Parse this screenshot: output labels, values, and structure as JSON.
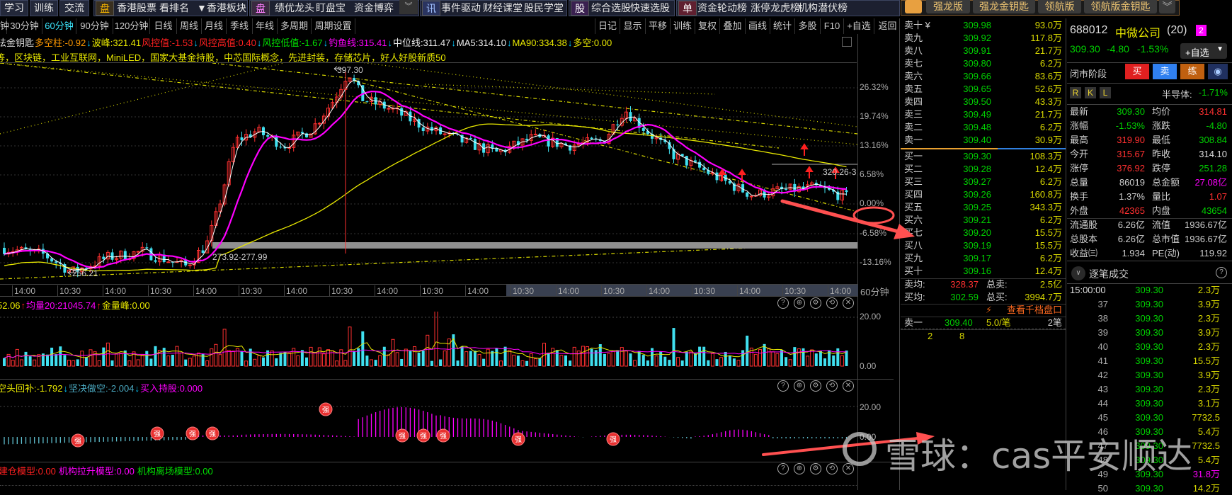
{
  "top_toolbar": {
    "left_buttons": [
      "学习",
      "训练",
      "交流"
    ],
    "group1_icon": "盘",
    "group1": [
      "香港股票",
      "看排名",
      "▼香港板块"
    ],
    "group2_icon": "盘",
    "group2": [
      "绩优龙头",
      "盯盘宝",
      "资金博弈"
    ],
    "group3_icon": "讯",
    "group3": [
      "事件驱动",
      "财经课堂",
      "股民学堂"
    ],
    "group4_icon": "股",
    "group4": [
      "综合选股",
      "快速选股"
    ],
    "group5_icon": "单",
    "group5": [
      "资金轮动榜",
      "涨停龙虎榜",
      "机构潜伏榜"
    ],
    "version_tabs": [
      "强龙版",
      "强龙金钥匙",
      "领航版",
      "领航版金钥匙"
    ]
  },
  "periods": [
    "钟",
    "30分钟",
    "60分钟",
    "90分钟",
    "120分钟",
    "日线",
    "周线",
    "月线",
    "季线",
    "年线",
    "多周期",
    "周期设置"
  ],
  "active_period": "60分钟",
  "chart_tools": [
    "日记",
    "显示",
    "平移",
    "训练",
    "复权",
    "叠加",
    "画线",
    "统计",
    "多股",
    "F10",
    "+自选",
    "返回"
  ],
  "indicator_line": [
    {
      "t": "法金钥匙",
      "c": "#dddddd"
    },
    {
      "t": "多空柱:-0.92",
      "c": "#ff9900"
    },
    {
      "t": "↓",
      "c": "#00c8ff"
    },
    {
      "t": "波峰:321.41",
      "c": "#e8e800"
    },
    {
      "t": "风控值:-1.53",
      "c": "#ff2020"
    },
    {
      "t": "↓",
      "c": "#00c8ff"
    },
    {
      "t": "风控高值:0.40",
      "c": "#ff2020"
    },
    {
      "t": "↓",
      "c": "#00c8ff"
    },
    {
      "t": "风控低值:-1.67",
      "c": "#00e000"
    },
    {
      "t": "↓",
      "c": "#00c8ff"
    },
    {
      "t": "钓鱼线:315.41",
      "c": "#ff00ff"
    },
    {
      "t": "↓",
      "c": "#00c8ff"
    },
    {
      "t": "中位线:311.47",
      "c": "#eeeeee"
    },
    {
      "t": "↓",
      "c": "#00c8ff"
    },
    {
      "t": "MA5:314.10",
      "c": "#eeeeee"
    },
    {
      "t": "↓",
      "c": "#00c8ff"
    },
    {
      "t": "MA90:334.38",
      "c": "#e8e800"
    },
    {
      "t": "↓",
      "c": "#00c8ff"
    },
    {
      "t": "多空:0.00",
      "c": "#e8e800"
    }
  ],
  "concepts": "等，区块链，工业互联网，MiniLED，国家大基金持股，中芯国际概念，先进封装，存储芯片，好人好股新质50",
  "main_chart": {
    "pct_labels": [
      "26.32%",
      "19.74%",
      "13.16%",
      "6.58%",
      "0.00%",
      "-6.58%",
      "-13.16%"
    ],
    "time_labels": [
      "14:00",
      "10:30",
      "14:00",
      "10:30",
      "14:00",
      "10:30",
      "14:00",
      "10:30",
      "14:00",
      "10:30",
      "14:00",
      "10:30",
      "14:00",
      "10:30",
      "14:00",
      "10:30",
      "14:00",
      "10:30",
      "14:00"
    ],
    "period_label": "60分钟",
    "annotations": {
      "high": "397.30",
      "low": "256.21",
      "band": "273.92-277.99",
      "range": "320.26-3"
    },
    "price_path": [
      [
        0,
        274.7
      ],
      [
        60,
        270
      ],
      [
        100,
        258
      ],
      [
        150,
        268
      ],
      [
        200,
        272
      ],
      [
        260,
        262
      ],
      [
        290,
        277
      ],
      [
        305,
        299
      ],
      [
        330,
        348
      ],
      [
        360,
        355
      ],
      [
        400,
        345
      ],
      [
        440,
        357
      ],
      [
        470,
        377
      ],
      [
        490,
        396
      ],
      [
        510,
        377
      ],
      [
        550,
        370
      ],
      [
        600,
        357
      ],
      [
        650,
        348
      ],
      [
        700,
        340
      ],
      [
        750,
        350
      ],
      [
        800,
        345
      ],
      [
        850,
        348
      ],
      [
        880,
        370
      ],
      [
        900,
        360
      ],
      [
        950,
        338
      ],
      [
        1000,
        326
      ],
      [
        1030,
        318
      ],
      [
        1060,
        311
      ],
      [
        1100,
        314
      ],
      [
        1150,
        316
      ],
      [
        1195,
        309.3
      ]
    ],
    "price_range": [
      250,
      400
    ],
    "colors": {
      "up": "#ff3030",
      "down": "#40e0f0",
      "ma_short": "#ffffff",
      "ma_mid": "#ff00ff",
      "ma_long": "#e8e800"
    }
  },
  "volume_panel": {
    "header": [
      {
        "t": "52.06",
        "c": "#e8e800"
      },
      {
        "t": "↑",
        "c": "#ff2020"
      },
      {
        "t": "均量20:21045.74",
        "c": "#ff00ff"
      },
      {
        "t": "↑",
        "c": "#ff2020"
      },
      {
        "t": "金量峰:0.00",
        "c": "#e8e800"
      }
    ],
    "y_labels": [
      "20.00",
      "0.00"
    ]
  },
  "signal_panel": {
    "header": [
      {
        "t": "空头回补:-1.792",
        "c": "#e8e800"
      },
      {
        "t": "↓",
        "c": "#00c8ff"
      },
      {
        "t": "坚决做空:-2.004",
        "c": "#4aa8c0"
      },
      {
        "t": "↓",
        "c": "#00c8ff"
      },
      {
        "t": "买入持股:0.000",
        "c": "#ff00ff"
      }
    ],
    "y_labels": [
      "20.00",
      "0.00"
    ],
    "badge": "强"
  },
  "model_panel": {
    "header": [
      {
        "t": "建仓模型:0.00",
        "c": "#ff2020"
      },
      {
        "t": "机构拉升模型:0.00",
        "c": "#ff00ff"
      },
      {
        "t": "机构离场模型:0.00",
        "c": "#00e000"
      }
    ]
  },
  "order_book": {
    "asks": [
      {
        "label": "卖十 ¥",
        "price": "309.98",
        "vol": "93.0万"
      },
      {
        "label": "卖九",
        "price": "309.92",
        "vol": "117.8万"
      },
      {
        "label": "卖八",
        "price": "309.91",
        "vol": "21.7万"
      },
      {
        "label": "卖七",
        "price": "309.80",
        "vol": "6.2万"
      },
      {
        "label": "卖六",
        "price": "309.66",
        "vol": "83.6万"
      },
      {
        "label": "卖五",
        "price": "309.65",
        "vol": "52.6万"
      },
      {
        "label": "卖四",
        "price": "309.50",
        "vol": "43.3万"
      },
      {
        "label": "卖三",
        "price": "309.49",
        "vol": "21.7万"
      },
      {
        "label": "卖二",
        "price": "309.48",
        "vol": "6.2万"
      },
      {
        "label": "卖一",
        "price": "309.40",
        "vol": "30.9万"
      }
    ],
    "bids": [
      {
        "label": "买一",
        "price": "309.30",
        "vol": "108.3万"
      },
      {
        "label": "买二",
        "price": "309.28",
        "vol": "12.4万"
      },
      {
        "label": "买三",
        "price": "309.27",
        "vol": "6.2万"
      },
      {
        "label": "买四",
        "price": "309.26",
        "vol": "160.8万"
      },
      {
        "label": "买五",
        "price": "309.25",
        "vol": "343.3万"
      },
      {
        "label": "买六",
        "price": "309.21",
        "vol": "6.2万"
      },
      {
        "label": "买七",
        "price": "309.20",
        "vol": "15.5万"
      },
      {
        "label": "买八",
        "price": "309.19",
        "vol": "15.5万"
      },
      {
        "label": "买九",
        "price": "309.17",
        "vol": "6.2万"
      },
      {
        "label": "买十",
        "price": "309.16",
        "vol": "12.4万"
      }
    ],
    "sell_avg_label": "卖均:",
    "sell_avg": "328.37",
    "total_sell_label": "总卖:",
    "total_sell": "2.5亿",
    "buy_avg_label": "买均:",
    "buy_avg": "302.59",
    "total_buy_label": "总买:",
    "total_buy": "3994.7万",
    "depth_link": "查看千档盘口",
    "queue": {
      "label": "卖一",
      "price": "309.40",
      "per": "5.0/笔",
      "count": "2笔",
      "items": [
        "2",
        "8"
      ]
    }
  },
  "quote": {
    "code": "688012",
    "name": "中微公司",
    "count": "(20)",
    "badge": "2",
    "price": "309.30",
    "change": "-4.80",
    "pct": "-1.53%",
    "watch_button": "+自选",
    "phase": "闭市阶段",
    "buy": "买",
    "sell": "卖",
    "practice": "练",
    "tags": [
      "R",
      "K",
      "L"
    ],
    "sector": "半导体:",
    "sector_pct": "-1.71%",
    "stats": [
      [
        "最新",
        "309.30",
        "g",
        "均价",
        "314.81",
        "r"
      ],
      [
        "涨幅",
        "-1.53%",
        "g",
        "涨跌",
        "-4.80",
        "g"
      ],
      [
        "最高",
        "319.90",
        "r",
        "最低",
        "308.84",
        "g"
      ],
      [
        "今开",
        "315.67",
        "r",
        "昨收",
        "314.10",
        "w"
      ],
      [
        "涨停",
        "376.92",
        "r",
        "跌停",
        "251.28",
        "g"
      ],
      [
        "总量",
        "86019",
        "lbl",
        "总金额",
        "27.08亿",
        "m"
      ],
      [
        "换手",
        "1.37%",
        "lbl",
        "量比",
        "1.07",
        "r"
      ],
      [
        "外盘",
        "42365",
        "r",
        "内盘",
        "43654",
        "g"
      ],
      [
        "流通股",
        "6.26亿",
        "lbl",
        "流值",
        "1936.67亿",
        "lbl"
      ],
      [
        "总股本",
        "6.26亿",
        "lbl",
        "总市值",
        "1936.67亿",
        "lbl"
      ],
      [
        "收益㈢",
        "1.934",
        "lbl",
        "PE(动)",
        "119.92",
        "lbl"
      ]
    ]
  },
  "ticks": {
    "title": "逐笔成交",
    "rows": [
      [
        "15:00:00",
        "309.30",
        "2.3万",
        "y"
      ],
      [
        "37",
        "309.30",
        "3.9万",
        "y"
      ],
      [
        "38",
        "309.30",
        "2.3万",
        "y"
      ],
      [
        "39",
        "309.30",
        "3.9万",
        "y"
      ],
      [
        "40",
        "309.30",
        "2.3万",
        "y"
      ],
      [
        "41",
        "309.30",
        "15.5万",
        "y"
      ],
      [
        "42",
        "309.30",
        "3.9万",
        "y"
      ],
      [
        "43",
        "309.30",
        "2.3万",
        "y"
      ],
      [
        "44",
        "309.30",
        "3.1万",
        "y"
      ],
      [
        "45",
        "309.30",
        "7732.5",
        "y"
      ],
      [
        "46",
        "309.30",
        "5.4万",
        "y"
      ],
      [
        "47",
        "309.30",
        "7732.5",
        "y"
      ],
      [
        "48",
        "309.30",
        "5.4万",
        "y"
      ],
      [
        "49",
        "309.30",
        "31.8万",
        "m"
      ],
      [
        "50",
        "309.30",
        "14.2万",
        "y"
      ]
    ]
  },
  "watermark": "雪球：cas平安顺达"
}
